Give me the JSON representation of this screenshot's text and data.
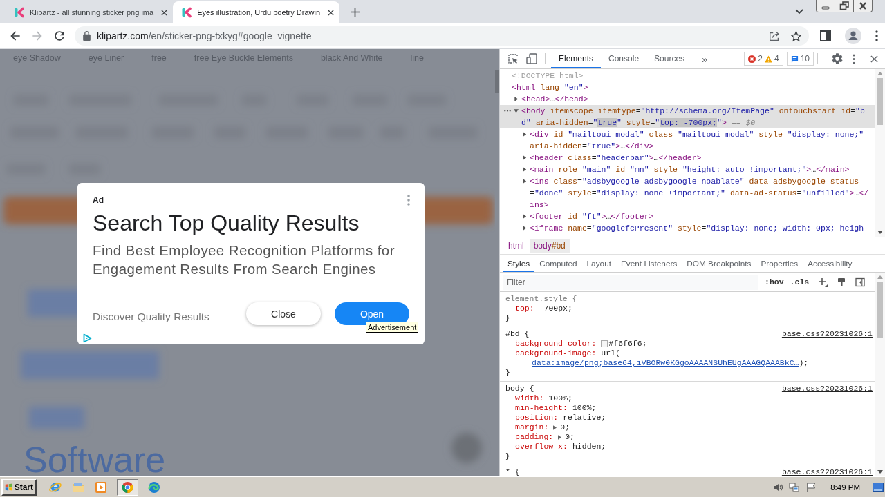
{
  "browser": {
    "tabs": [
      {
        "title": "Klipartz - all stunning sticker png ima",
        "selected": false
      },
      {
        "title": "Eyes illustration, Urdu poetry Drawin",
        "selected": true
      }
    ],
    "nav_buttons": [
      {
        "kind": "back",
        "disabled": false
      },
      {
        "kind": "forward",
        "disabled": true
      },
      {
        "kind": "reload",
        "disabled": false
      }
    ],
    "address": {
      "host": "klipartz.com",
      "path": "/en/sticker-png-txkyg#google_vignette"
    }
  },
  "page": {
    "tags": [
      "eye Shadow",
      "eye Liner",
      "free",
      "free Eye Buckle Elements",
      "black And White",
      "line"
    ],
    "heading": "Software"
  },
  "ad": {
    "label": "Ad",
    "title": "Search Top Quality Results",
    "description": "Find Best Employee Recognition Platforms for Engagement Results From Search Engines",
    "footer_text": "Discover Quality Results",
    "buttons": [
      {
        "label": "Close",
        "kind": "secondary"
      },
      {
        "label": "Open",
        "kind": "primary"
      }
    ],
    "tooltip": "Advertisement"
  },
  "devtools": {
    "tabs": [
      {
        "label": "Elements",
        "selected": true
      },
      {
        "label": "Console",
        "selected": false
      },
      {
        "label": "Sources",
        "selected": false
      }
    ],
    "more_tabs": "»",
    "issues": {
      "errors": "2",
      "warnings": "4",
      "messages": "10"
    },
    "dom": [
      {
        "selected": false,
        "tokens": [
          {
            "kind": "doctype",
            "text": "<!DOCTYPE html>"
          }
        ]
      },
      {
        "selected": false,
        "tokens": [
          {
            "kind": "tag",
            "text": "<html"
          },
          {
            "kind": "attr",
            "text": " lang"
          },
          {
            "kind": "text",
            "text": "="
          },
          {
            "kind": "value",
            "text": "\"en\""
          },
          {
            "kind": "tag",
            "text": ">"
          }
        ],
        "children": [
          {
            "selected": false,
            "expanded": false,
            "tokens": [
              {
                "kind": "tag",
                "text": "<head>"
              },
              {
                "kind": "text",
                "text": "…"
              },
              {
                "kind": "tag",
                "text": "</head>"
              }
            ]
          },
          {
            "selected": true,
            "expanded": true,
            "tokens": [
              {
                "kind": "tag",
                "text": "<body"
              },
              {
                "kind": "attr",
                "text": " itemscope itemtype"
              },
              {
                "kind": "text",
                "text": "="
              },
              {
                "kind": "value",
                "text": "\"http://schema.org/ItemPage\""
              },
              {
                "kind": "attr",
                "text": " ontouchstart id"
              },
              {
                "kind": "text",
                "text": "="
              },
              {
                "kind": "value",
                "text": "\"bd\""
              },
              {
                "kind": "attr",
                "text": " aria-hidden"
              },
              {
                "kind": "text",
                "text": "="
              },
              {
                "kind": "value",
                "text": "\""
              },
              {
                "kind": "match",
                "text": "true"
              },
              {
                "kind": "value",
                "text": "\""
              },
              {
                "kind": "attr",
                "text": " style"
              },
              {
                "kind": "text",
                "text": "="
              },
              {
                "kind": "value",
                "text": "\""
              },
              {
                "kind": "match",
                "text": "top: -700px;"
              },
              {
                "kind": "value",
                "text": "\""
              },
              {
                "kind": "tag",
                "text": ">"
              },
              {
                "kind": "ref",
                "text": " == $0"
              }
            ],
            "children": [
              {
                "selected": false,
                "expanded": false,
                "tokens": [
                  {
                    "kind": "tag",
                    "text": "<div"
                  },
                  {
                    "kind": "attr",
                    "text": " id"
                  },
                  {
                    "kind": "text",
                    "text": "="
                  },
                  {
                    "kind": "value",
                    "text": "\"mailtoui-modal\""
                  },
                  {
                    "kind": "attr",
                    "text": " class"
                  },
                  {
                    "kind": "text",
                    "text": "="
                  },
                  {
                    "kind": "value",
                    "text": "\"mailtoui-modal\""
                  },
                  {
                    "kind": "attr",
                    "text": " style"
                  },
                  {
                    "kind": "text",
                    "text": "="
                  },
                  {
                    "kind": "value",
                    "text": "\"display: none;\""
                  },
                  {
                    "kind": "attr",
                    "text": " aria-hidden"
                  },
                  {
                    "kind": "text",
                    "text": "="
                  },
                  {
                    "kind": "value",
                    "text": "\"true\""
                  },
                  {
                    "kind": "tag",
                    "text": ">"
                  },
                  {
                    "kind": "text",
                    "text": "…"
                  },
                  {
                    "kind": "tag",
                    "text": "</div>"
                  }
                ]
              },
              {
                "selected": false,
                "expanded": false,
                "tokens": [
                  {
                    "kind": "tag",
                    "text": "<header"
                  },
                  {
                    "kind": "attr",
                    "text": " class"
                  },
                  {
                    "kind": "text",
                    "text": "="
                  },
                  {
                    "kind": "value",
                    "text": "\"headerbar\""
                  },
                  {
                    "kind": "tag",
                    "text": ">"
                  },
                  {
                    "kind": "text",
                    "text": "…"
                  },
                  {
                    "kind": "tag",
                    "text": "</header>"
                  }
                ]
              },
              {
                "selected": false,
                "expanded": false,
                "tokens": [
                  {
                    "kind": "tag",
                    "text": "<main"
                  },
                  {
                    "kind": "attr",
                    "text": " role"
                  },
                  {
                    "kind": "text",
                    "text": "="
                  },
                  {
                    "kind": "value",
                    "text": "\"main\""
                  },
                  {
                    "kind": "attr",
                    "text": " id"
                  },
                  {
                    "kind": "text",
                    "text": "="
                  },
                  {
                    "kind": "value",
                    "text": "\"mn\""
                  },
                  {
                    "kind": "attr",
                    "text": " style"
                  },
                  {
                    "kind": "text",
                    "text": "="
                  },
                  {
                    "kind": "value",
                    "text": "\"height: auto !important;\""
                  },
                  {
                    "kind": "tag",
                    "text": ">"
                  },
                  {
                    "kind": "text",
                    "text": "…"
                  },
                  {
                    "kind": "tag",
                    "text": "</main>"
                  }
                ]
              },
              {
                "selected": false,
                "expanded": false,
                "tokens": [
                  {
                    "kind": "tag",
                    "text": "<ins"
                  },
                  {
                    "kind": "attr",
                    "text": " class"
                  },
                  {
                    "kind": "text",
                    "text": "="
                  },
                  {
                    "kind": "value",
                    "text": "\"adsbygoogle adsbygoogle-noablate\""
                  },
                  {
                    "kind": "attr",
                    "text": " data-adsbygoogle-status"
                  },
                  {
                    "kind": "text",
                    "text": "="
                  },
                  {
                    "kind": "value",
                    "text": "\"done\""
                  },
                  {
                    "kind": "attr",
                    "text": " style"
                  },
                  {
                    "kind": "text",
                    "text": "="
                  },
                  {
                    "kind": "value",
                    "text": "\"display: none !important;\""
                  },
                  {
                    "kind": "attr",
                    "text": " data-ad-status"
                  },
                  {
                    "kind": "text",
                    "text": "="
                  },
                  {
                    "kind": "value",
                    "text": "\"unfilled\""
                  },
                  {
                    "kind": "tag",
                    "text": ">"
                  },
                  {
                    "kind": "text",
                    "text": "…"
                  },
                  {
                    "kind": "tag",
                    "text": "</ins>"
                  }
                ]
              },
              {
                "selected": false,
                "expanded": false,
                "tokens": [
                  {
                    "kind": "tag",
                    "text": "<footer"
                  },
                  {
                    "kind": "attr",
                    "text": " id"
                  },
                  {
                    "kind": "text",
                    "text": "="
                  },
                  {
                    "kind": "value",
                    "text": "\"ft\""
                  },
                  {
                    "kind": "tag",
                    "text": ">"
                  },
                  {
                    "kind": "text",
                    "text": "…"
                  },
                  {
                    "kind": "tag",
                    "text": "</footer>"
                  }
                ]
              },
              {
                "selected": false,
                "expanded": false,
                "tokens": [
                  {
                    "kind": "tag",
                    "text": "<iframe"
                  },
                  {
                    "kind": "attr",
                    "text": " name"
                  },
                  {
                    "kind": "text",
                    "text": "="
                  },
                  {
                    "kind": "value",
                    "text": "\"googlefcPresent\""
                  },
                  {
                    "kind": "attr",
                    "text": " style"
                  },
                  {
                    "kind": "text",
                    "text": "="
                  },
                  {
                    "kind": "value",
                    "text": "\"display: none; width: 0px; heigh"
                  }
                ]
              }
            ]
          }
        ]
      }
    ],
    "breadcrumbs": [
      {
        "tag": "html",
        "selected": false
      },
      {
        "tag": "body",
        "id_suffix": "#bd",
        "selected": true
      }
    ],
    "styles_tabs": [
      {
        "label": "Styles",
        "selected": true
      },
      {
        "label": "Computed",
        "selected": false
      },
      {
        "label": "Layout",
        "selected": false
      },
      {
        "label": "Event Listeners",
        "selected": false
      },
      {
        "label": "DOM Breakpoints",
        "selected": false
      },
      {
        "label": "Properties",
        "selected": false
      },
      {
        "label": "Accessibility",
        "selected": false
      }
    ],
    "filter": {
      "placeholder": "Filter"
    },
    "filter_toggles": [
      ":hov",
      ".cls"
    ],
    "rules": [
      {
        "kind": "inline",
        "selector": "element.style {",
        "declarations": [
          {
            "property": "top:",
            "value": "-700px;",
            "expandable": false
          }
        ],
        "close": "}"
      },
      {
        "kind": "matched",
        "selector": "#bd {",
        "source": "base.css?20231026:1",
        "declarations": [
          {
            "property": "background-color:",
            "color": "#f6f6f6",
            "value": "#f6f6f6;",
            "expandable": false
          },
          {
            "property": "background-image:",
            "value": "url(",
            "link": "data:image/png;base64,iVBORw0KGgoAAAANSUhEUgAAAGQAAABkC…",
            "value_end": ");",
            "expandable": false
          }
        ],
        "close": "}"
      },
      {
        "kind": "matched",
        "selector": "body {",
        "source": "base.css?20231026:1",
        "declarations": [
          {
            "property": "width:",
            "value": "100%;",
            "expandable": false
          },
          {
            "property": "min-height:",
            "value": "100%;",
            "expandable": false
          },
          {
            "property": "position:",
            "value": "relative;",
            "expandable": false
          },
          {
            "property": "margin:",
            "value": "0;",
            "expandable": true
          },
          {
            "property": "padding:",
            "value": "0;",
            "expandable": true
          },
          {
            "property": "overflow-x:",
            "value": "hidden;",
            "expandable": false
          }
        ],
        "close": "}"
      },
      {
        "kind": "matched",
        "selector": "* {",
        "source": "base.css?20231026:1"
      }
    ]
  },
  "taskbar": {
    "start": "Start",
    "apps": [
      {
        "kind": "ie",
        "selected": false
      },
      {
        "kind": "explorer",
        "selected": false
      },
      {
        "kind": "media",
        "selected": false
      },
      {
        "kind": "chrome",
        "selected": true
      },
      {
        "kind": "edge",
        "selected": false
      }
    ],
    "clock": "8:49 PM"
  }
}
